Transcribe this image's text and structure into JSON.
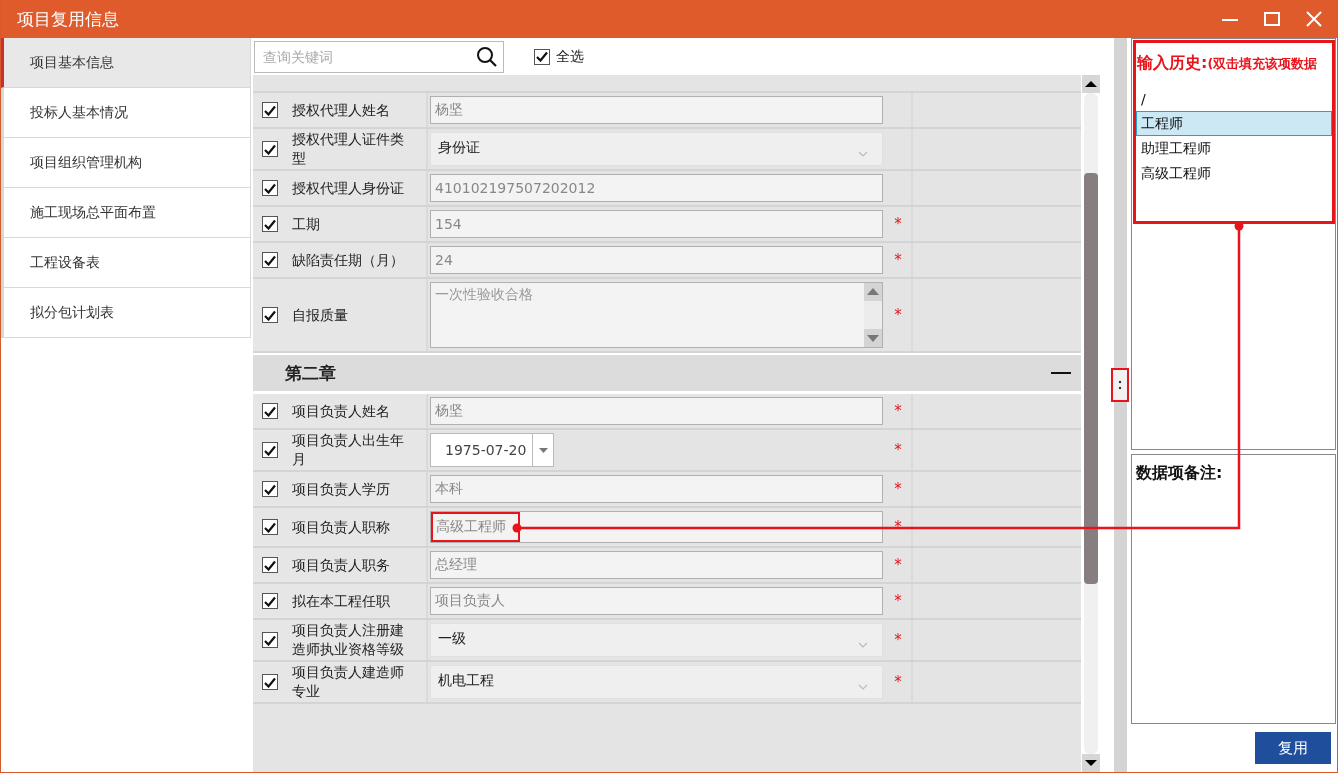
{
  "window": {
    "title": "项目复用信息"
  },
  "sidebar": {
    "items": [
      {
        "label": "项目基本信息",
        "selected": true
      },
      {
        "label": "投标人基本情况",
        "selected": false
      },
      {
        "label": "项目组织管理机构",
        "selected": false
      },
      {
        "label": "施工现场总平面布置",
        "selected": false
      },
      {
        "label": "工程设备表",
        "selected": false
      },
      {
        "label": "拟分包计划表",
        "selected": false
      }
    ]
  },
  "search": {
    "placeholder": "查询关键词"
  },
  "select_all": {
    "label": "全选",
    "checked": true
  },
  "sections": [
    {
      "rows": [
        {
          "label": "授权代理人姓名",
          "kind": "text",
          "value": "杨坚",
          "checked": true,
          "required": false,
          "highlighted": false
        },
        {
          "label": "授权代理人证件类型",
          "kind": "select",
          "value": "身份证",
          "checked": true,
          "required": false,
          "highlighted": false
        },
        {
          "label": "授权代理人身份证",
          "kind": "text",
          "value": "410102197507202012",
          "checked": true,
          "required": false,
          "highlighted": false
        },
        {
          "label": "工期",
          "kind": "text",
          "value": "154",
          "checked": true,
          "required": true,
          "highlighted": false
        },
        {
          "label": "缺陷责任期（月）",
          "kind": "text",
          "value": "24",
          "checked": true,
          "required": true,
          "highlighted": false
        },
        {
          "label": "自报质量",
          "kind": "textarea",
          "value": "一次性验收合格",
          "checked": true,
          "required": true,
          "highlighted": false
        }
      ]
    },
    {
      "title": "第二章",
      "expanded": true,
      "rows": [
        {
          "label": "项目负责人姓名",
          "kind": "text",
          "value": "杨坚",
          "checked": true,
          "required": true,
          "highlighted": false
        },
        {
          "label": "项目负责人出生年月",
          "kind": "date",
          "value": "1975-07-20",
          "checked": true,
          "required": true,
          "highlighted": false
        },
        {
          "label": "项目负责人学历",
          "kind": "text",
          "value": "本科",
          "checked": true,
          "required": true,
          "highlighted": false
        },
        {
          "label": "项目负责人职称",
          "kind": "text",
          "value": "高级工程师",
          "checked": true,
          "required": true,
          "highlighted": true
        },
        {
          "label": "项目负责人职务",
          "kind": "text",
          "value": "总经理",
          "checked": true,
          "required": true,
          "highlighted": false
        },
        {
          "label": "拟在本工程任职",
          "kind": "text",
          "value": "项目负责人",
          "checked": true,
          "required": true,
          "highlighted": false
        },
        {
          "label": "项目负责人注册建造师执业资格等级",
          "kind": "select",
          "value": "一级",
          "checked": true,
          "required": true,
          "highlighted": false
        },
        {
          "label": "项目负责人建造师专业",
          "kind": "select",
          "value": "机电工程",
          "checked": true,
          "required": true,
          "highlighted": false
        }
      ]
    }
  ],
  "required_mark": "*",
  "splitter": {
    "highlighted": true
  },
  "history": {
    "title": "输入历史:",
    "hint": "(双击填充该项数据",
    "highlighted": true,
    "items": [
      {
        "label": "/",
        "selected": false
      },
      {
        "label": "工程师",
        "selected": true
      },
      {
        "label": "助理工程师",
        "selected": false
      },
      {
        "label": "高级工程师",
        "selected": false
      }
    ]
  },
  "notes": {
    "title": "数据项备注:"
  },
  "buttons": [
    "复用"
  ]
}
